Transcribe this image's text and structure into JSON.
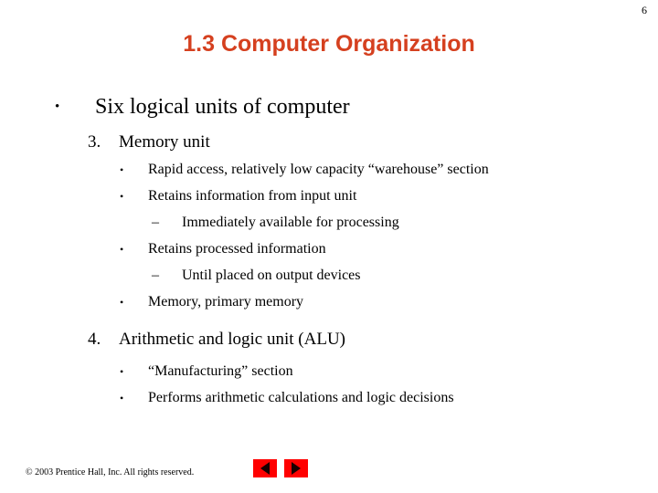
{
  "slide": {
    "page_number": "6",
    "title": "1.3 Computer Organization",
    "title_color": "#D5401F",
    "background_color": "#FFFFFF"
  },
  "content": {
    "main_bullet": {
      "marker": "•",
      "text": "Six logical units of computer"
    },
    "items": [
      {
        "level": 2,
        "marker": "3.",
        "text": "Memory unit"
      },
      {
        "level": 3,
        "marker": "•",
        "text": "Rapid access, relatively low capacity “warehouse” section"
      },
      {
        "level": 3,
        "marker": "•",
        "text": "Retains information from input unit"
      },
      {
        "level": 4,
        "marker": "–",
        "text": "Immediately available for processing"
      },
      {
        "level": 3,
        "marker": "•",
        "text": "Retains processed information"
      },
      {
        "level": 4,
        "marker": "–",
        "text": "Until placed on output devices"
      },
      {
        "level": 3,
        "marker": "•",
        "text": "Memory, primary memory"
      },
      {
        "level": 2,
        "marker": "4.",
        "text": "Arithmetic and logic unit (ALU)"
      },
      {
        "level": 3,
        "marker": "•",
        "text": "“Manufacturing” section"
      },
      {
        "level": 3,
        "marker": "•",
        "text": "Performs arithmetic calculations and logic decisions"
      }
    ]
  },
  "footer": {
    "copyright": "© 2003 Prentice Hall, Inc.  All rights reserved.",
    "button_color": "#FF0000",
    "prev_label": "previous-slide",
    "next_label": "next-slide"
  }
}
